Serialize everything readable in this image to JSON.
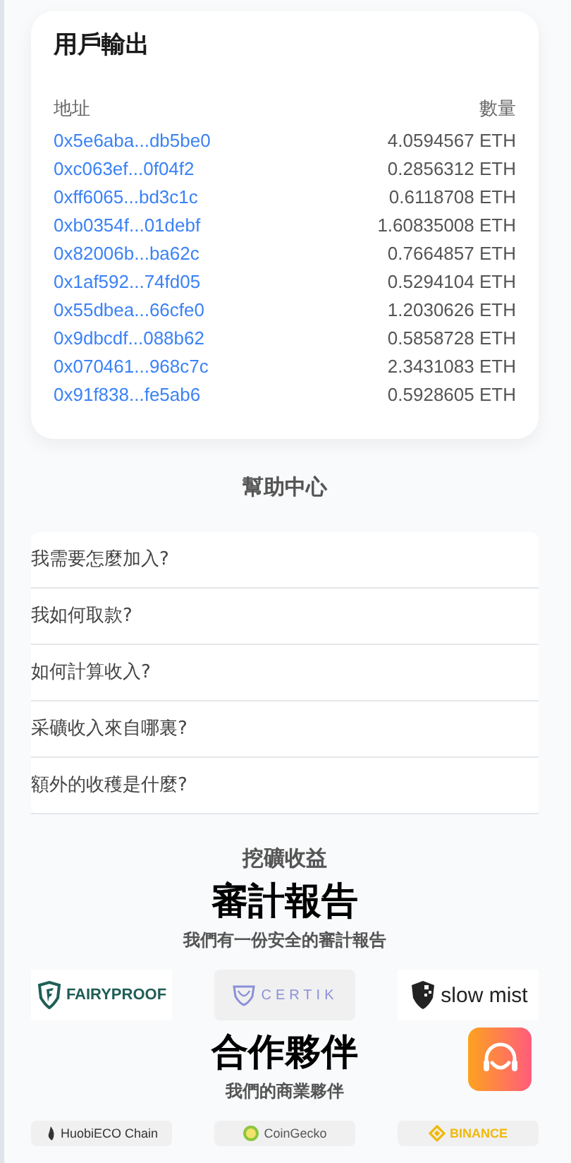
{
  "outputs": {
    "title": "用戶輸出",
    "columns": [
      "地址",
      "數量"
    ],
    "rows": [
      {
        "address": "0x5e6aba...db5be0",
        "amount": "4.0594567 ETH"
      },
      {
        "address": "0xc063ef...0f04f2",
        "amount": "0.2856312 ETH"
      },
      {
        "address": "0xff6065...bd3c1c",
        "amount": "0.6118708 ETH"
      },
      {
        "address": "0xb0354f...01debf",
        "amount": "1.60835008 ETH"
      },
      {
        "address": "0x82006b...ba62c",
        "amount": "0.7664857 ETH"
      },
      {
        "address": "0x1af592...74fd05",
        "amount": "0.5294104 ETH"
      },
      {
        "address": "0x55dbea...66cfe0",
        "amount": "1.2030626 ETH"
      },
      {
        "address": "0x9dbcdf...088b62",
        "amount": "0.5858728 ETH"
      },
      {
        "address": "0x070461...968c7c",
        "amount": "2.3431083 ETH"
      },
      {
        "address": "0x91f838...fe5ab6",
        "amount": "0.5928605 ETH"
      }
    ]
  },
  "help": {
    "title": "幫助中心",
    "questions": [
      "我需要怎麼加入?",
      "我如何取款?",
      "如何計算收入?",
      "采礦收入來自哪裏?",
      "額外的收穫是什麼?"
    ]
  },
  "earnings": {
    "title": "挖礦收益"
  },
  "audit": {
    "title": "審計報告",
    "subtitle": "我們有一份安全的審計報告",
    "logos": [
      {
        "kind": "fairyproof",
        "name": "FAIRYPROOF"
      },
      {
        "kind": "certik",
        "name": "CERTIK"
      },
      {
        "kind": "slowmist",
        "name": "slow mist"
      }
    ]
  },
  "partners": {
    "title": "合作夥伴",
    "subtitle": "我們的商業夥伴",
    "logos": [
      {
        "kind": "huobi",
        "name": "HuobiECO Chain"
      },
      {
        "kind": "coingecko",
        "name": "CoinGecko"
      },
      {
        "kind": "binance",
        "name": "BINANCE"
      }
    ]
  }
}
